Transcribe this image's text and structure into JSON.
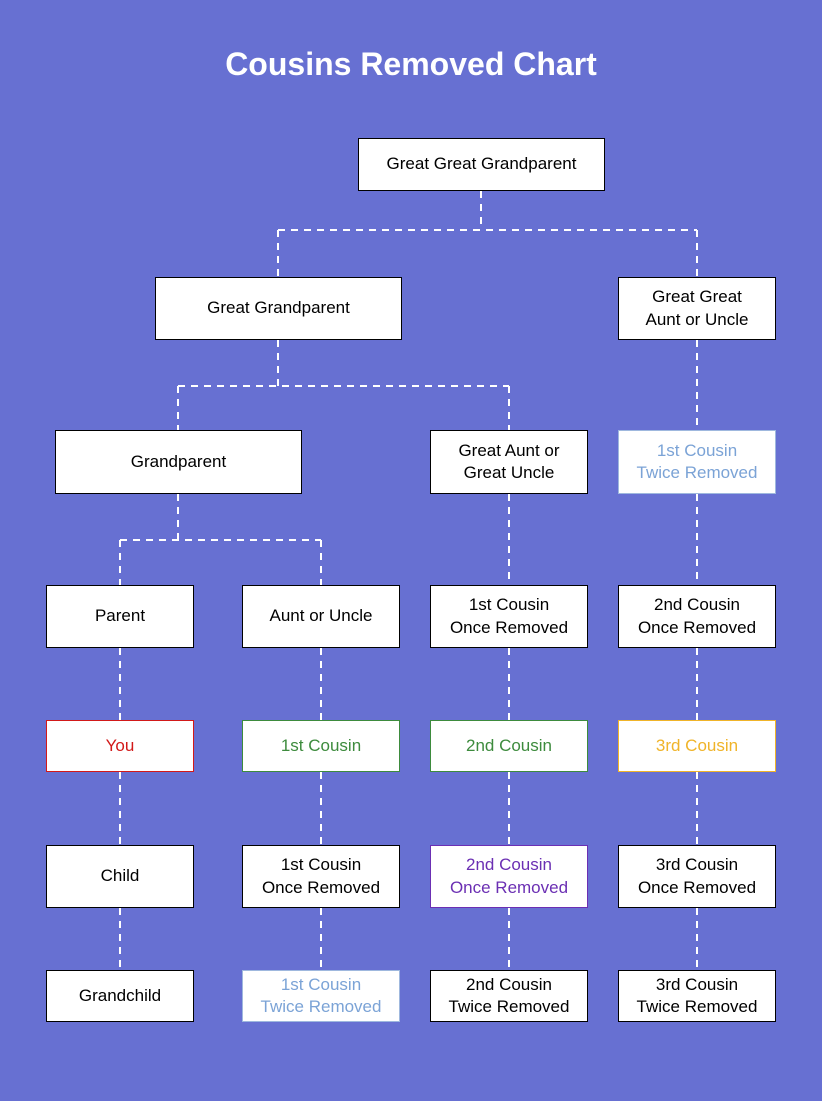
{
  "title": "Cousins Removed Chart",
  "chart_data": {
    "type": "tree",
    "title": "Cousins Removed Chart",
    "levels": [
      [
        "Great Great Grandparent"
      ],
      [
        "Great Grandparent",
        "Great Great Aunt or Uncle"
      ],
      [
        "Grandparent",
        "Great Aunt or Great Uncle",
        "1st Cousin Twice Removed"
      ],
      [
        "Parent",
        "Aunt or Uncle",
        "1st Cousin Once Removed",
        "2nd Cousin Once Removed"
      ],
      [
        "You",
        "1st Cousin",
        "2nd Cousin",
        "3rd Cousin"
      ],
      [
        "Child",
        "1st Cousin Once Removed",
        "2nd Cousin Once Removed",
        "3rd Cousin Once Removed"
      ],
      [
        "Grandchild",
        "1st Cousin Twice Removed",
        "2nd Cousin Twice Removed",
        "3rd Cousin Twice Removed"
      ]
    ],
    "highlights": {
      "You": "red",
      "1st Cousin": "green",
      "2nd Cousin": "green",
      "3rd Cousin": "orange",
      "1st Cousin Twice Removed": "blue",
      "2nd Cousin Once Removed (level 6)": "purple"
    }
  },
  "nodes": {
    "gggrandparent": "Great Great Grandparent",
    "ggrandparent": "Great Grandparent",
    "gg_aunt_uncle": "Great Great\nAunt or Uncle",
    "grandparent": "Grandparent",
    "great_aunt_uncle": "Great Aunt or\nGreat Uncle",
    "c1_twice_a": "1st Cousin\nTwice Removed",
    "parent": "Parent",
    "aunt_uncle": "Aunt or Uncle",
    "c1_once_a": "1st Cousin\nOnce Removed",
    "c2_once_a": "2nd Cousin\nOnce Removed",
    "you": "You",
    "c1": "1st Cousin",
    "c2": "2nd Cousin",
    "c3": "3rd Cousin",
    "child": "Child",
    "c1_once_b": "1st Cousin\nOnce Removed",
    "c2_once_b": "2nd Cousin\nOnce Removed",
    "c3_once": "3rd Cousin\nOnce Removed",
    "grandchild": "Grandchild",
    "c1_twice_b": "1st Cousin\nTwice Removed",
    "c2_twice": "2nd Cousin\nTwice Removed",
    "c3_twice": "3rd Cousin\nTwice Removed"
  }
}
